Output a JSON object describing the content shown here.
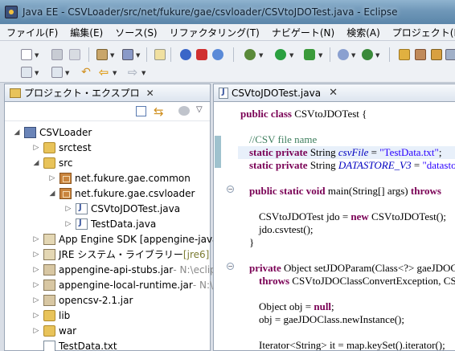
{
  "window": {
    "title": "Java EE - CSVLoader/src/net/fukure/gae/csvloader/CSVtoJDOTest.java - Eclipse"
  },
  "menu": {
    "items": [
      "ファイル(F)",
      "編集(E)",
      "ソース(S)",
      "リファクタリング(T)",
      "ナビゲート(N)",
      "検索(A)",
      "プロジェクト(P)"
    ]
  },
  "left_panel": {
    "tab_label": "プロジェクト・エクスプロ",
    "tree": [
      {
        "label": "CSVLoader",
        "icon": "project-icon",
        "extra": ""
      },
      {
        "label": "srctest",
        "icon": "source-folder-icon",
        "extra": ""
      },
      {
        "label": "src",
        "icon": "source-folder-icon",
        "extra": ""
      },
      {
        "label": "net.fukure.gae.common",
        "icon": "package-icon",
        "extra": ""
      },
      {
        "label": "net.fukure.gae.csvloader",
        "icon": "package-icon",
        "extra": ""
      },
      {
        "label": "CSVtoJDOTest.java",
        "icon": "java-file-icon",
        "extra": ""
      },
      {
        "label": "TestData.java",
        "icon": "java-file-icon",
        "extra": ""
      },
      {
        "label": "App Engine SDK [appengine-java-s",
        "icon": "library-icon",
        "extra": ""
      },
      {
        "label": "JRE システム・ライブラリー ",
        "icon": "library-icon",
        "extra": "[jre6]"
      },
      {
        "label": "appengine-api-stubs.jar",
        "icon": "jar-icon",
        "extra": " - N:\\eclips"
      },
      {
        "label": "appengine-local-runtime.jar",
        "icon": "jar-icon",
        "extra": " - N:\\e"
      },
      {
        "label": "opencsv-2.1.jar",
        "icon": "jar-icon",
        "extra": ""
      },
      {
        "label": "lib",
        "icon": "folder-icon",
        "extra": ""
      },
      {
        "label": "war",
        "icon": "folder-icon",
        "extra": ""
      },
      {
        "label": "TestData.txt",
        "icon": "text-file-icon",
        "extra": ""
      }
    ]
  },
  "editor": {
    "tab_label": "CSVtoJDOTest.java",
    "code": {
      "class_decl_kw": "public class",
      "class_decl_rest": " CSVtoJDOTest {",
      "comment": "//CSV file name",
      "f1_kw": "static private",
      "f1_type": " String ",
      "f1_name": "csvFile",
      "f1_eq": " = ",
      "f1_val": "\"TestData.txt\"",
      "f1_end": ";",
      "f2_kw": "static private",
      "f2_type": " String ",
      "f2_name": "DATASTORE_V3",
      "f2_eq": " = ",
      "f2_val": "\"datastor",
      "main_kw": "public static void",
      "main_rest": " main(String[] args) ",
      "main_throws": "throws",
      "l8_a": "CSVtoJDOTest jdo = ",
      "l8_kw": "new",
      "l8_b": " CSVtoJDOTest();",
      "l9": "jdo.csvtest();",
      "l10": "}",
      "m2_kw": "private",
      "m2_rest": " Object setJDOParam(Class<?> gaeJDOC",
      "m2_throws": "throws",
      "m2_exc": " CSVtoJDOClassConvertException, CS",
      "l14_a": "Object obj = ",
      "l14_kw": "null",
      "l14_b": ";",
      "l15": "obj = gaeJDOClass.newInstance();",
      "l17": "Iterator<String> it = map.keySet().iterator();"
    }
  }
}
